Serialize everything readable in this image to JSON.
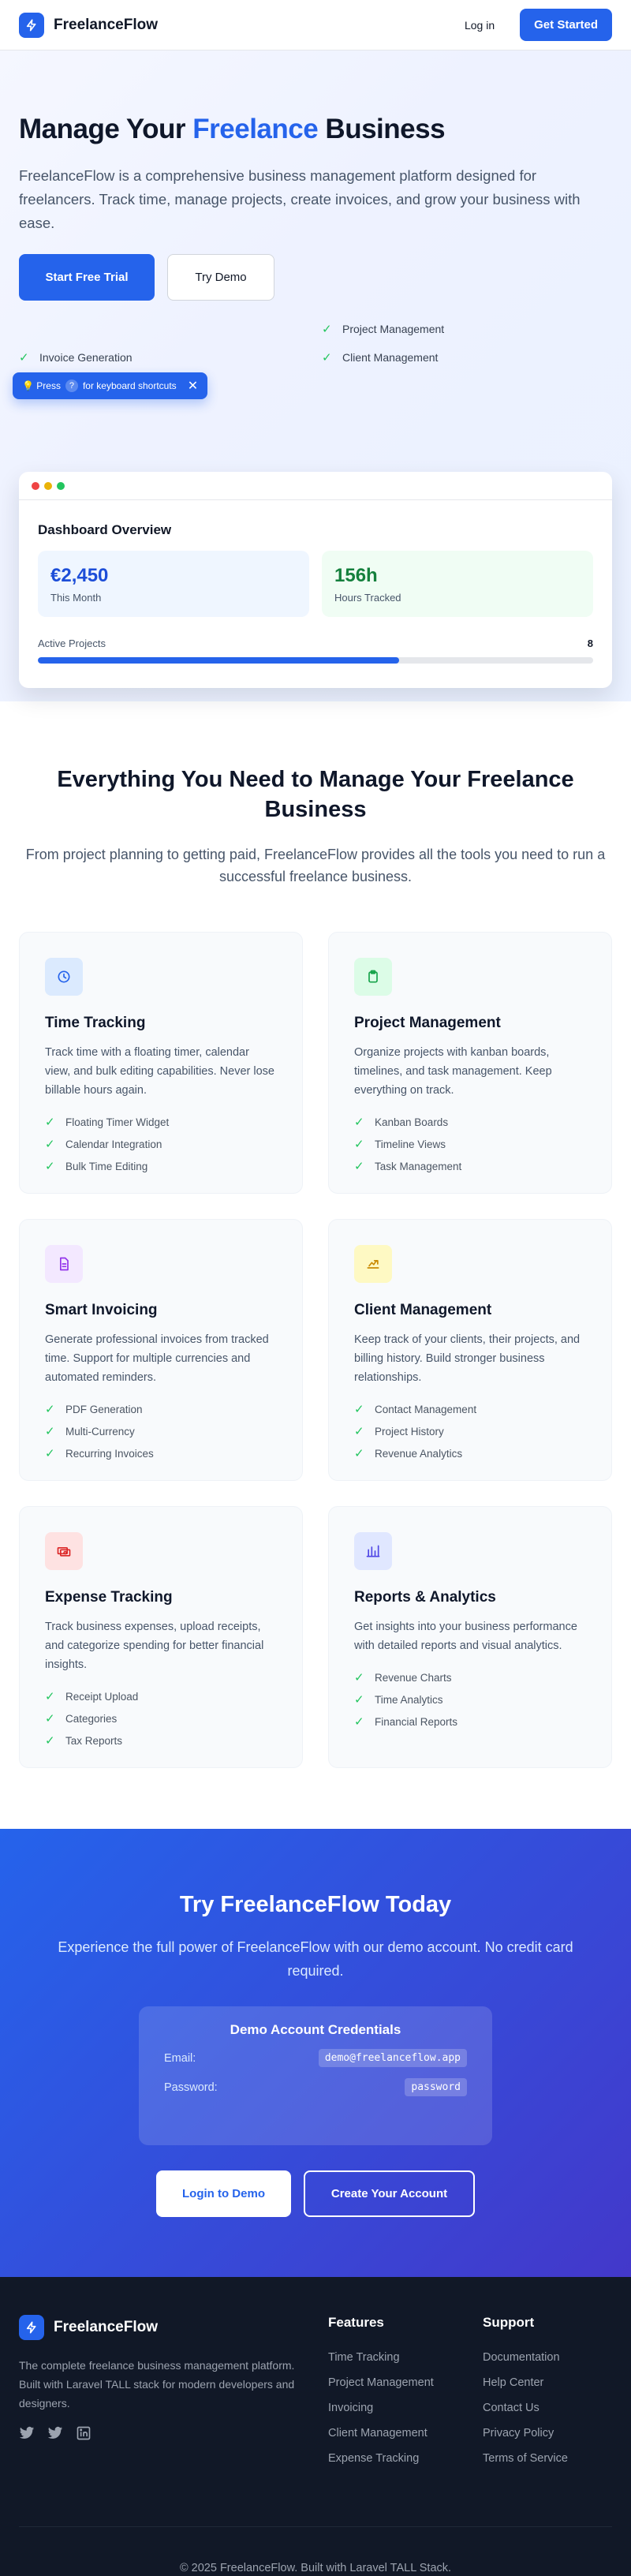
{
  "header": {
    "brand": "FreelanceFlow",
    "login": "Log in",
    "get_started": "Get Started"
  },
  "hero": {
    "title_before": "Manage Your ",
    "title_accent": "Freelance",
    "title_after": " Business",
    "description": "FreelanceFlow is a comprehensive business management platform designed for freelancers. Track time, manage projects, create invoices, and grow your business with ease.",
    "primary_button": "Start Free Trial",
    "secondary_button": "Try Demo",
    "features": [
      "Project Management",
      "Invoice Generation",
      "Client Management"
    ],
    "tooltip": {
      "before": "💡 Press",
      "key": "?",
      "after": "for keyboard shortcuts",
      "close": "✕"
    },
    "dashboard": {
      "title": "Dashboard Overview",
      "earnings_value": "€2,450",
      "earnings_label": "This Month",
      "hours_value": "156h",
      "hours_label": "Hours Tracked",
      "active_projects_label": "Active Projects",
      "active_projects_count": "8",
      "progress_fraction": 0.65
    }
  },
  "features_section": {
    "title": "Everything You Need to Manage Your Freelance Business",
    "description": "From project planning to getting paid, FreelanceFlow provides all the tools you need to run a successful freelance business.",
    "cards": [
      {
        "icon": "clock-icon",
        "icon_bg": "#dbeafe",
        "icon_color": "#2563eb",
        "title": "Time Tracking",
        "description": "Track time with a floating timer, calendar view, and bulk editing capabilities. Never lose billable hours again.",
        "items": [
          "Floating Timer Widget",
          "Calendar Integration",
          "Bulk Time Editing"
        ]
      },
      {
        "icon": "clipboard-icon",
        "icon_bg": "#dcfce7",
        "icon_color": "#16a34a",
        "title": "Project Management",
        "description": "Organize projects with kanban boards, timelines, and task management. Keep everything on track.",
        "items": [
          "Kanban Boards",
          "Timeline Views",
          "Task Management"
        ]
      },
      {
        "icon": "document-icon",
        "icon_bg": "#f3e8ff",
        "icon_color": "#9333ea",
        "title": "Smart Invoicing",
        "description": "Generate professional invoices from tracked time. Support for multiple currencies and automated reminders.",
        "items": [
          "PDF Generation",
          "Multi-Currency",
          "Recurring Invoices"
        ]
      },
      {
        "icon": "handshake-icon",
        "icon_bg": "#fef9c3",
        "icon_color": "#ca8a04",
        "title": "Client Management",
        "description": "Keep track of your clients, their projects, and billing history. Build stronger business relationships.",
        "items": [
          "Contact Management",
          "Project History",
          "Revenue Analytics"
        ]
      },
      {
        "icon": "cash-icon",
        "icon_bg": "#fee2e2",
        "icon_color": "#dc2626",
        "title": "Expense Tracking",
        "description": "Track business expenses, upload receipts, and categorize spending for better financial insights.",
        "items": [
          "Receipt Upload",
          "Categories",
          "Tax Reports"
        ]
      },
      {
        "icon": "bar-chart-icon",
        "icon_bg": "#e0e7ff",
        "icon_color": "#4f46e5",
        "title": "Reports & Analytics",
        "description": "Get insights into your business performance with detailed reports and visual analytics.",
        "items": [
          "Revenue Charts",
          "Time Analytics",
          "Financial Reports"
        ]
      }
    ]
  },
  "cta": {
    "title": "Try FreelanceFlow Today",
    "description": "Experience the full power of FreelanceFlow with our demo account. No credit card required.",
    "credentials_title": "Demo Account Credentials",
    "email_label": "Email:",
    "email_value": "demo@freelanceflow.app",
    "password_label": "Password:",
    "password_value": "password",
    "login_button": "Login to Demo",
    "create_button": "Create Your Account"
  },
  "footer": {
    "brand": "FreelanceFlow",
    "description": "The complete freelance business management platform. Built with Laravel TALL stack for modern developers and designers.",
    "social_icons": [
      "twitter-icon",
      "twitter-icon",
      "linkedin-icon"
    ],
    "features_heading": "Features",
    "features_links": [
      "Time Tracking",
      "Project Management",
      "Invoicing",
      "Client Management",
      "Expense Tracking"
    ],
    "support_heading": "Support",
    "support_links": [
      "Documentation",
      "Help Center",
      "Contact Us",
      "Privacy Policy",
      "Terms of Service"
    ],
    "copyright": "© 2025 FreelanceFlow. Built with Laravel TALL Stack."
  },
  "colors": {
    "primary": "#2563eb",
    "check": "#22c55e",
    "footer_bg": "#111827"
  }
}
